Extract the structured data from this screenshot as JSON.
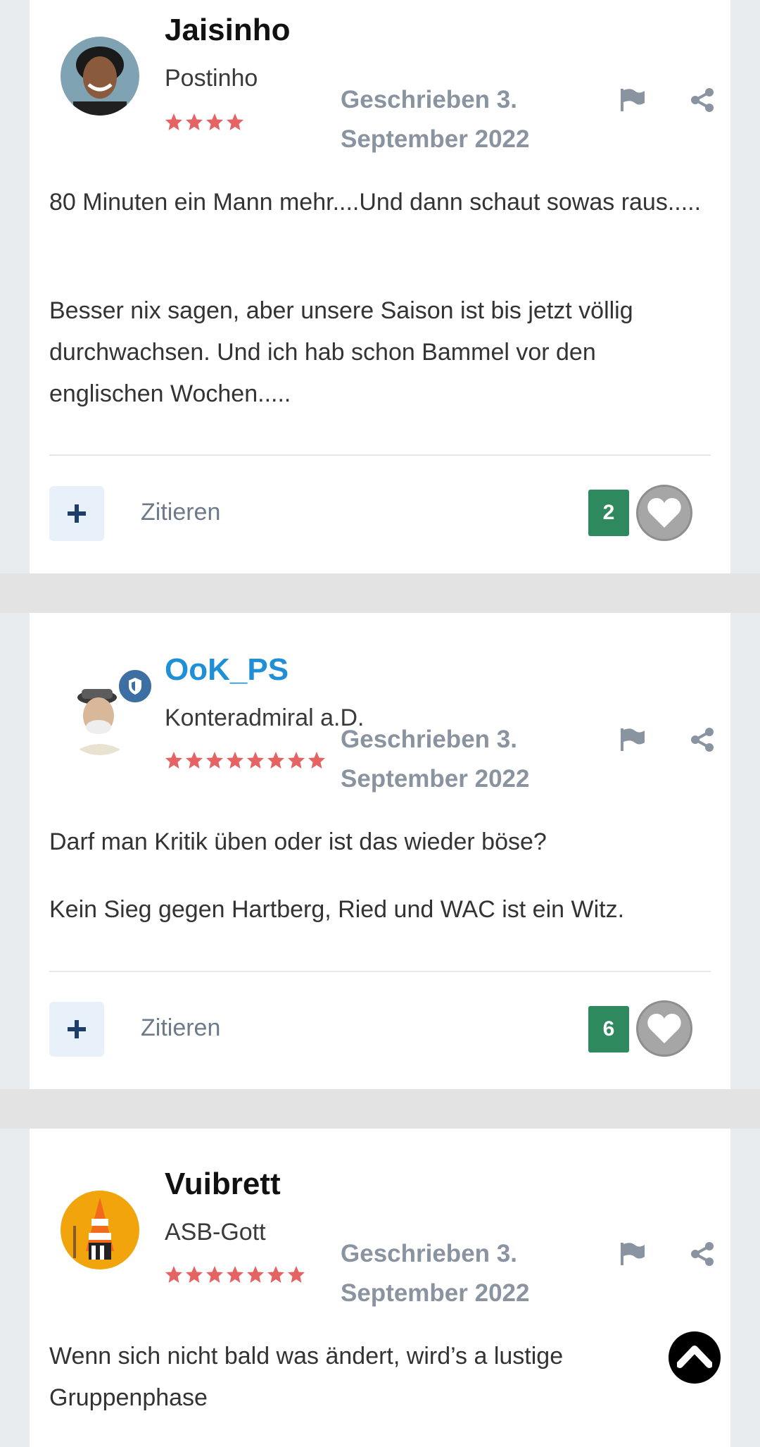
{
  "posts": [
    {
      "author": "Jaisinho",
      "rank": "Postinho",
      "stars": 4,
      "date": "Geschrieben 3. September 2022",
      "paragraphs": [
        "80 Minuten ein Mann mehr....Und dann schaut sowas raus.....",
        "Besser nix sagen, aber unsere Saison ist bis jetzt völlig durchwachsen. Und ich hab schon Bammel vor den englischen Wochen....."
      ],
      "quote_label": "Zitieren",
      "reaction_count": "2"
    },
    {
      "author": "OoK_PS",
      "rank": "Konteradmiral a.D.",
      "stars": 8,
      "date": "Geschrieben 3. September 2022",
      "paragraphs": [
        "Darf man Kritik üben oder ist das wieder böse?",
        "Kein Sieg gegen Hartberg, Ried und WAC ist ein Witz."
      ],
      "quote_label": "Zitieren",
      "reaction_count": "6"
    },
    {
      "author": "Vuibrett",
      "rank": "ASB-Gott",
      "stars": 7,
      "date": "Geschrieben 3. September 2022",
      "paragraphs": [
        "Wenn sich nicht bald was ändert, wird’s a lustige Gruppenphase"
      ]
    }
  ],
  "colors": {
    "staff_name": "#1f8fd8",
    "reaction_badge": "#2e8a5e",
    "star": "#e04848"
  },
  "icons": [
    "flag-icon",
    "share-icon",
    "plus-icon",
    "heart-icon",
    "chevron-up-icon",
    "moderator-shield-icon"
  ]
}
